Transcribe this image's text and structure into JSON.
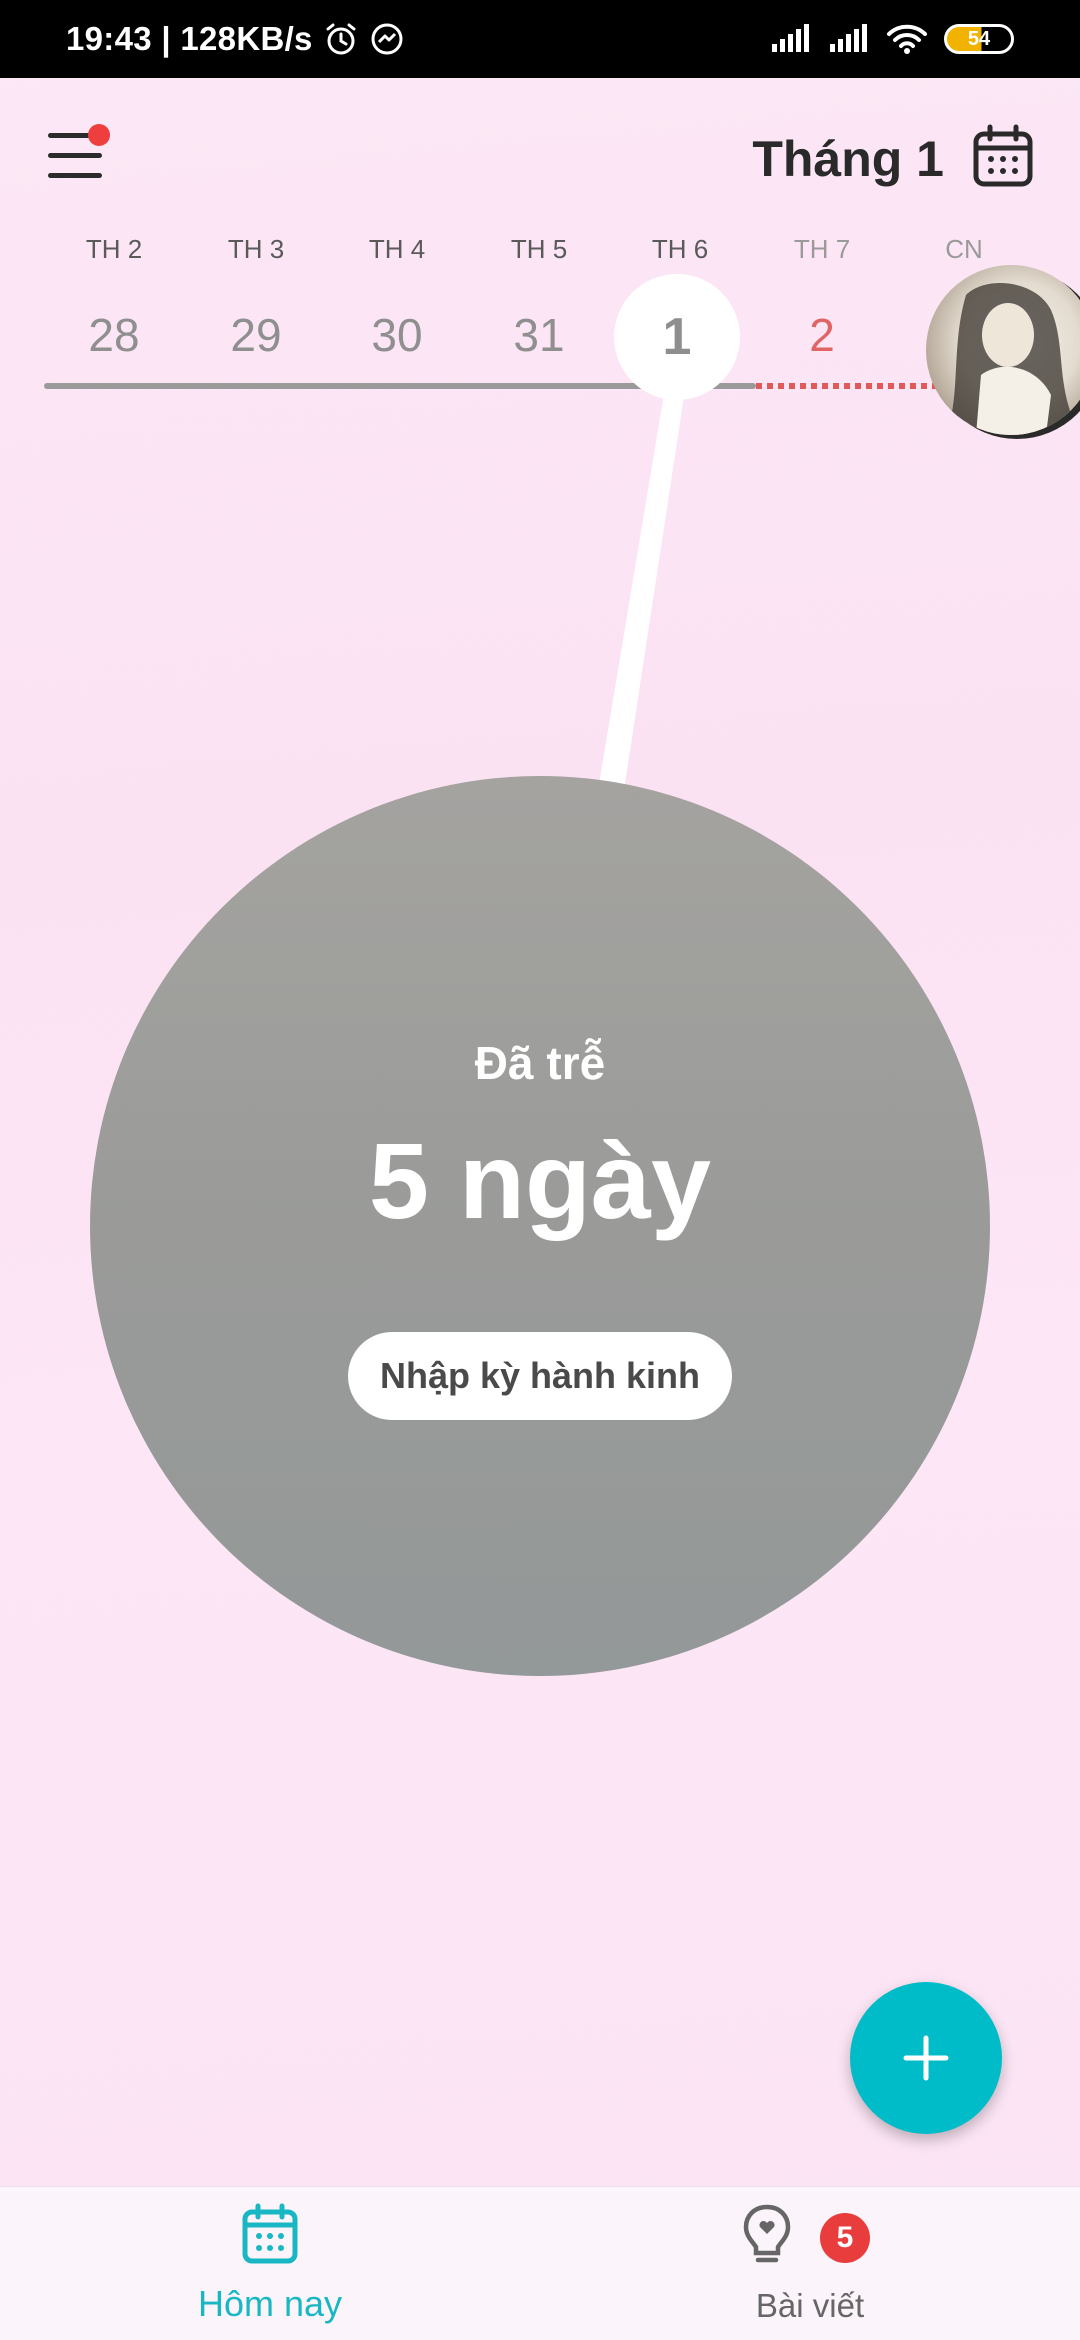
{
  "status_bar": {
    "time_speed": "19:43 | 128KB/s",
    "battery": "54"
  },
  "header": {
    "month_title": "Tháng 1"
  },
  "week": {
    "weekdays": [
      "TH 2",
      "TH 3",
      "TH 4",
      "TH 5",
      "TH 6",
      "TH 7",
      "CN"
    ],
    "days": [
      "28",
      "29",
      "30",
      "31",
      "1",
      "2"
    ],
    "today_index": 4
  },
  "status_circle": {
    "subtitle": "Đã trễ",
    "value": "5 ngày",
    "button_label": "Nhập kỳ hành kinh"
  },
  "bottom_nav": {
    "today_label": "Hôm nay",
    "articles_label": "Bài viết",
    "articles_badge": "5"
  },
  "colors": {
    "accent": "#00bcc9",
    "alert": "#e93d3d",
    "circle": "#9a9b99",
    "future_day": "#e06464"
  }
}
